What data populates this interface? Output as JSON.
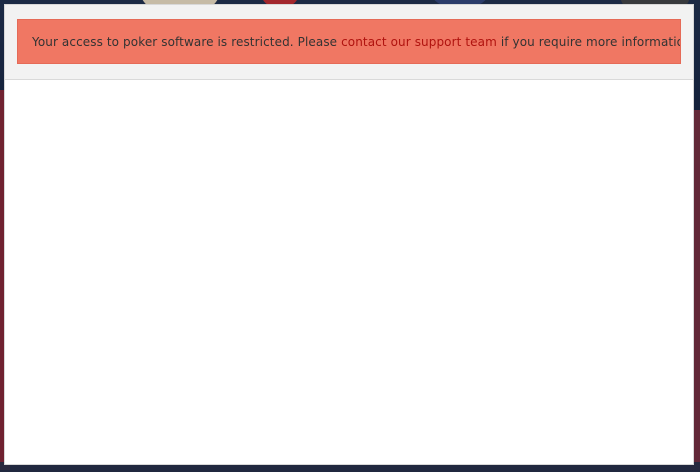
{
  "alert": {
    "text_before": "Your access to poker software is restricted. Please",
    "link_text": "contact our support team",
    "text_after": "if you require more information.",
    "background_color": "#f07763",
    "link_color": "#b0130f"
  }
}
